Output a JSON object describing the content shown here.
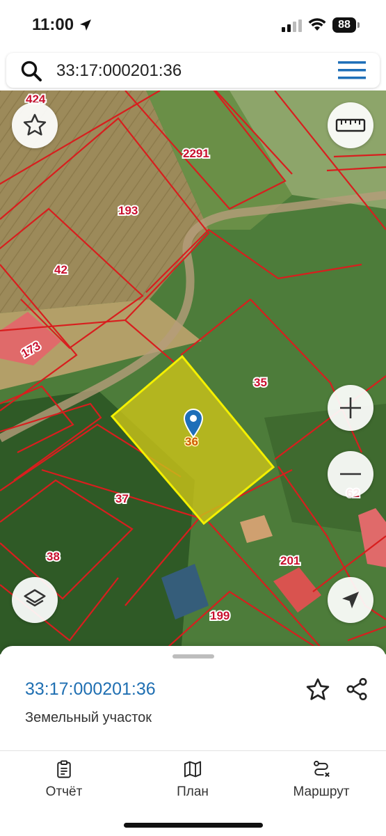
{
  "status_bar": {
    "time": "11:00",
    "battery": "88"
  },
  "search": {
    "query": "33:17:000201:36"
  },
  "map": {
    "parcel_labels": [
      {
        "id": "424",
        "text": "424"
      },
      {
        "id": "2291",
        "text": "2291"
      },
      {
        "id": "193",
        "text": "193"
      },
      {
        "id": "42",
        "text": "42"
      },
      {
        "id": "173",
        "text": "173"
      },
      {
        "id": "35",
        "text": "35"
      },
      {
        "id": "36",
        "text": "36"
      },
      {
        "id": "37",
        "text": "37"
      },
      {
        "id": "38",
        "text": "38"
      },
      {
        "id": "201",
        "text": "201"
      },
      {
        "id": "199",
        "text": "199"
      },
      {
        "id": "62",
        "text": "62"
      }
    ],
    "selected_parcel": "36",
    "colors": {
      "boundary": "#d81e1e",
      "selected_fill": "#c9c21a",
      "selected_outline": "#f4f000",
      "pin": "#1e6fb8"
    }
  },
  "sheet": {
    "title": "33:17:000201:36",
    "subtitle": "Земельный участок"
  },
  "tabs": [
    {
      "id": "report",
      "label": "Отчёт",
      "icon": "clipboard-icon"
    },
    {
      "id": "plan",
      "label": "План",
      "icon": "map-icon"
    },
    {
      "id": "route",
      "label": "Маршрут",
      "icon": "route-icon"
    }
  ]
}
